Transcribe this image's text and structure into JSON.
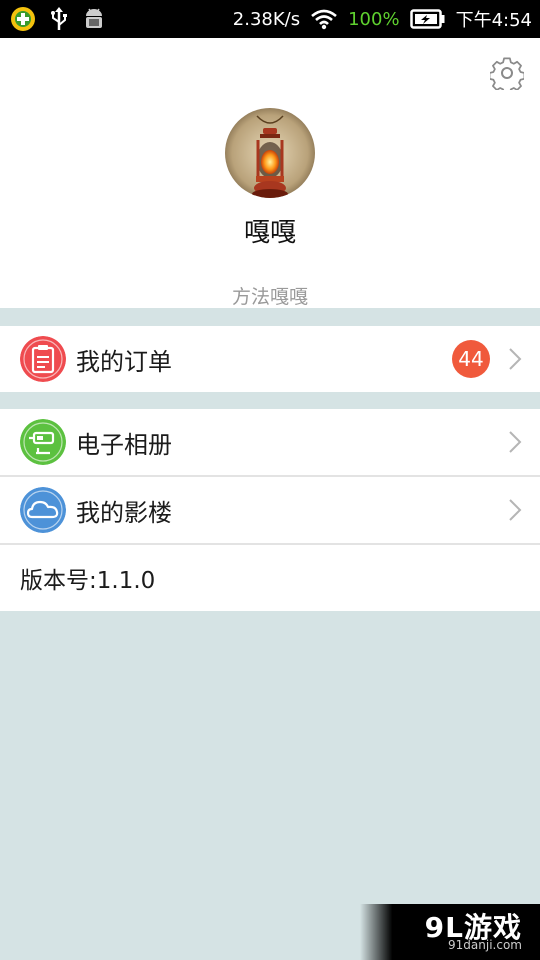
{
  "status_bar": {
    "icons_left": [
      "plus-circle-icon",
      "usb-icon",
      "android-debug-icon"
    ],
    "net_speed": "2.38K/s",
    "battery_percent": "100%",
    "time": "下午4:54",
    "accent_green": "#5fd12f"
  },
  "profile": {
    "name": "嘎嘎",
    "signature": "方法嘎嘎"
  },
  "menu": {
    "orders": {
      "label": "我的订单",
      "badge": "44",
      "icon": "clipboard-icon",
      "icon_color": "#ef4b4f"
    },
    "album": {
      "label": "电子相册",
      "icon": "album-icon",
      "icon_color": "#5cc140"
    },
    "cinema": {
      "label": "我的影楼",
      "icon": "cloud-icon",
      "icon_color": "#4d92d8"
    },
    "version": "版本号:1.1.0"
  },
  "watermark": {
    "brand": "9L游戏",
    "url": "91danji.com"
  }
}
